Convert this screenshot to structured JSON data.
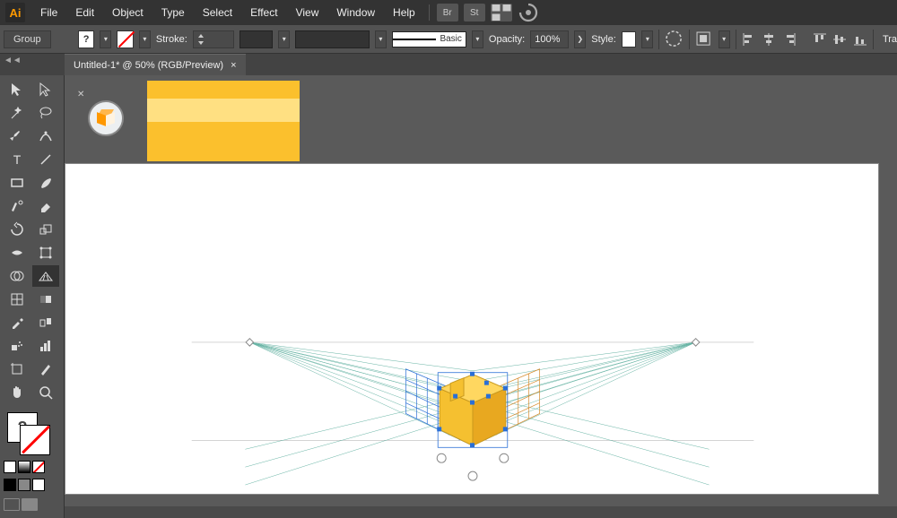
{
  "app": {
    "logo": "Ai"
  },
  "menu": [
    "File",
    "Edit",
    "Object",
    "Type",
    "Select",
    "Effect",
    "View",
    "Window",
    "Help"
  ],
  "top_icons": [
    "Br",
    "St"
  ],
  "control": {
    "group_label": "Group",
    "fill_q": "?",
    "stroke_label": "Stroke:",
    "style_label": "Basic",
    "opacity_label": "Opacity:",
    "opacity_value": "100%",
    "style_text": "Style:",
    "transform_label": "Tra"
  },
  "tab": {
    "title": "Untitled-1* @ 50% (RGB/Preview)",
    "close": "×"
  },
  "fill_stroke": {
    "fill_q": "?"
  },
  "panel_handle": "◄◄"
}
